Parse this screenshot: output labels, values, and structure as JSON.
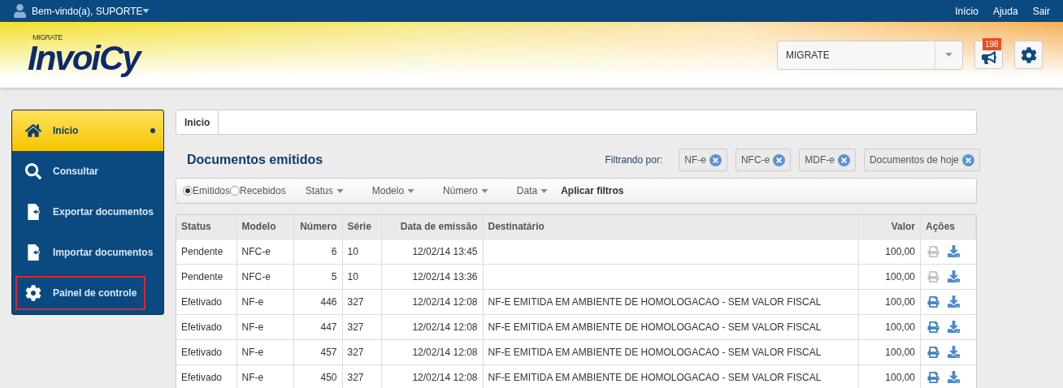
{
  "topbar": {
    "welcome": "Bem-vindo(a), SUPORTE",
    "links": [
      "Início",
      "Ajuda",
      "Sair"
    ]
  },
  "header": {
    "logo_small": "MIGRATE",
    "logo": "InvoiCy",
    "company_select": {
      "value": "MIGRATE"
    },
    "notifications": {
      "count": "198"
    }
  },
  "sidebar": {
    "items": [
      {
        "label": "Início",
        "kind": "home",
        "selected": true,
        "highlighted": false
      },
      {
        "label": "Consultar",
        "kind": "search",
        "selected": false,
        "highlighted": false
      },
      {
        "label": "Exportar documentos",
        "kind": "export",
        "selected": false,
        "highlighted": false
      },
      {
        "label": "Importar documentos",
        "kind": "import",
        "selected": false,
        "highlighted": false
      },
      {
        "label": "Painel de controle",
        "kind": "gear",
        "selected": false,
        "highlighted": true
      }
    ]
  },
  "breadcrumb": "Inicio",
  "title": "Documentos emitidos",
  "filters": {
    "label": "Filtrando por:",
    "tags": [
      "NF-e",
      "NFC-e",
      "MDF-e",
      "Documentos de hoje"
    ]
  },
  "toolbar": {
    "radios": [
      {
        "label": "Emitidos",
        "selected": true
      },
      {
        "label": "Recebidos",
        "selected": false
      }
    ],
    "dropdowns": [
      "Status",
      "Modelo",
      "Número",
      "Data"
    ],
    "apply": "Aplicar filtros"
  },
  "table": {
    "columns": [
      "Status",
      "Modelo",
      "Número",
      "Série",
      "Data de emissão",
      "Destinatário",
      "Valor",
      "Ações"
    ],
    "rows": [
      {
        "cells": [
          "Pendente",
          "NFC-e",
          "6",
          "10",
          "12/02/14 13:45",
          "",
          "100,00"
        ],
        "print_enabled": false
      },
      {
        "cells": [
          "Pendente",
          "NFC-e",
          "5",
          "10",
          "12/02/14 13:36",
          "",
          "100,00"
        ],
        "print_enabled": false
      },
      {
        "cells": [
          "Efetivado",
          "NF-e",
          "446",
          "327",
          "12/02/14 12:08",
          "NF-E EMITIDA EM AMBIENTE DE HOMOLOGACAO - SEM VALOR FISCAL",
          "100,00"
        ],
        "print_enabled": true
      },
      {
        "cells": [
          "Efetivado",
          "NF-e",
          "447",
          "327",
          "12/02/14 12:08",
          "NF-E EMITIDA EM AMBIENTE DE HOMOLOGACAO - SEM VALOR FISCAL",
          "100,00"
        ],
        "print_enabled": true
      },
      {
        "cells": [
          "Efetivado",
          "NF-e",
          "457",
          "327",
          "12/02/14 12:08",
          "NF-E EMITIDA EM AMBIENTE DE HOMOLOGACAO - SEM VALOR FISCAL",
          "100,00"
        ],
        "print_enabled": true
      },
      {
        "cells": [
          "Efetivado",
          "NF-e",
          "450",
          "327",
          "12/02/14 12:08",
          "NF-E EMITIDA EM AMBIENTE DE HOMOLOGACAO - SEM VALOR FISCAL",
          "100,00"
        ],
        "print_enabled": true
      }
    ]
  }
}
